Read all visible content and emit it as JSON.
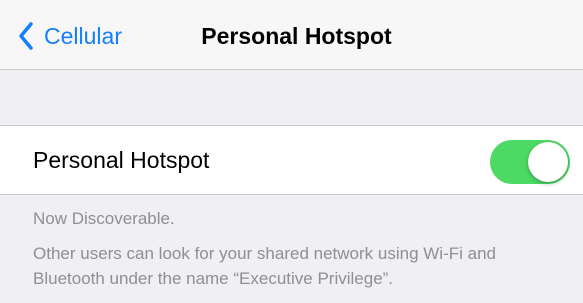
{
  "navbar": {
    "back_label": "Cellular",
    "title": "Personal Hotspot"
  },
  "hotspot_cell": {
    "label": "Personal Hotspot",
    "toggle_on": true
  },
  "footer": {
    "status": "Now Discoverable.",
    "description": "Other users can look for your shared network using Wi-Fi and Bluetooth under the name “Executive Privilege”."
  },
  "colors": {
    "accent": "#157efb",
    "toggle_on": "#4cd964",
    "background": "#efeff4",
    "footer_text": "#8e8e93"
  }
}
